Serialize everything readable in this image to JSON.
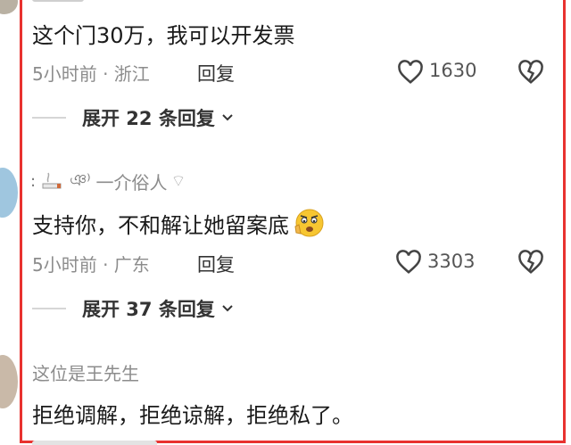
{
  "comments": [
    {
      "username": "",
      "text": "这个门30万，我可以开发票",
      "time_location": "5小时前 · 浙江",
      "reply_label": "回复",
      "likes": "1630",
      "expand_label": "展开 22 条回复"
    },
    {
      "username": "一介俗人",
      "username_prefix_icons": "smoking-icon",
      "text": "支持你，不和解让她留案底",
      "time_location": "5小时前 · 广东",
      "reply_label": "回复",
      "likes": "3303",
      "expand_label": "展开 37 条回复"
    },
    {
      "username": "这位是王先生",
      "text": "拒绝调解，拒绝谅解，拒绝私了。"
    }
  ],
  "colors": {
    "highlight_border": "#e8322f",
    "meta_gray": "#8c8c8c"
  }
}
